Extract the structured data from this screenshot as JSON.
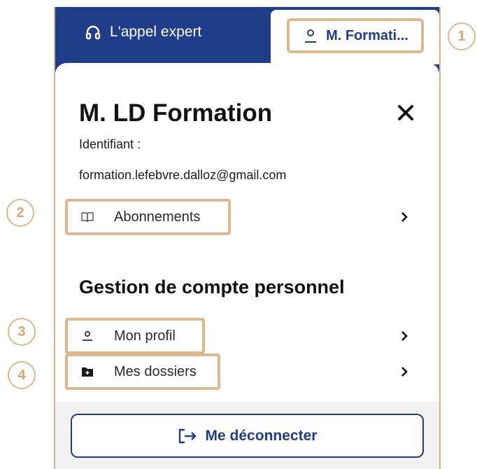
{
  "header": {
    "expert_label": "L'appel expert",
    "user_short_label": "M. Formati..."
  },
  "account": {
    "name": "M. LD Formation",
    "identifier_label": "Identifiant :",
    "email": "formation.lefebvre.dalloz@gmail.com"
  },
  "menu": {
    "subscriptions_label": "Abonnements",
    "personal_section_title": "Gestion de compte personnel",
    "profile_label": "Mon profil",
    "folders_label": "Mes dossiers"
  },
  "footer": {
    "logout_label": "Me déconnecter"
  },
  "annotations": [
    "1",
    "2",
    "3",
    "4"
  ],
  "colors": {
    "primary": "#203d8a",
    "highlight": "#ddb98d",
    "badge_text": "#d9a86c"
  },
  "icons": [
    "headset-icon",
    "user-icon",
    "close-icon",
    "book-icon",
    "folder-plus-icon",
    "chevron-right-icon",
    "logout-icon"
  ]
}
